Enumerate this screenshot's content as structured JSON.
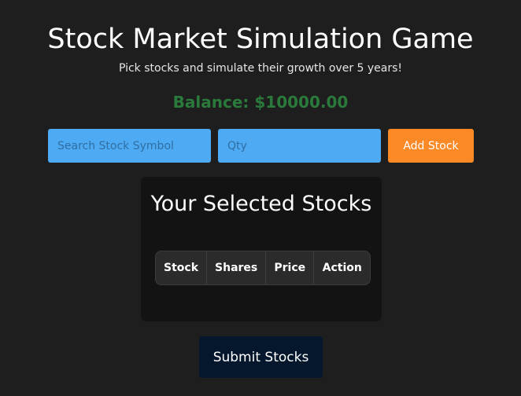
{
  "header": {
    "title": "Stock Market Simulation Game",
    "subtitle": "Pick stocks and simulate their growth over 5 years!",
    "balance_label": "Balance:",
    "balance_value": "$10000.00"
  },
  "form": {
    "search_placeholder": "Search Stock Symbol",
    "search_value": "",
    "qty_placeholder": "Qty",
    "qty_value": "",
    "add_label": "Add Stock"
  },
  "panel": {
    "title": "Your Selected Stocks",
    "columns": [
      "Stock",
      "Shares",
      "Price",
      "Action"
    ],
    "rows": []
  },
  "actions": {
    "submit_label": "Submit Stocks"
  },
  "colors": {
    "background": "#1e1e1f",
    "panel": "#131313",
    "input": "#4eaaf2",
    "accent_orange": "#fb8a26",
    "balance_green": "#2a7a3b",
    "submit_navy": "#04172d"
  }
}
